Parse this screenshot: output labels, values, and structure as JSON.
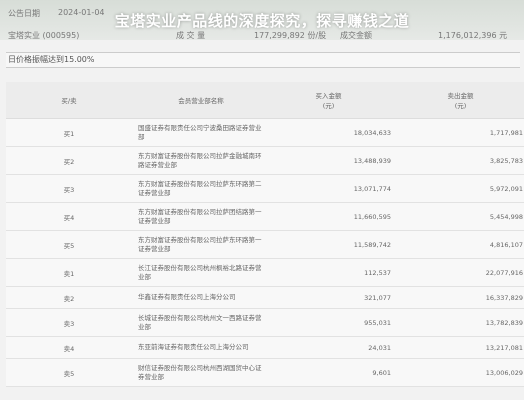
{
  "header": {
    "notice_label": "公告日期",
    "notice_date": "2024-01-04",
    "stock_label": "宝塔实业 (000595)",
    "volume_label": "成 交 量",
    "volume_value": "177,299,892 份/股",
    "amount_label": "成交金额",
    "amount_value": "1,176,012,396 元",
    "title": "宝塔实业产品线的深度探究，探寻赚钱之道"
  },
  "reason": "日价格振幅达到15.00%",
  "table": {
    "headers": [
      "买/卖",
      "会员营业部名称",
      "买入金额\n(元)",
      "卖出金额\n(元)"
    ],
    "rows": [
      {
        "side": "买1",
        "dept": "国盛证券有限责任公司宁波桑田路证券营业部",
        "buy": "18,034,633",
        "sell": "1,717,981"
      },
      {
        "side": "买2",
        "dept": "东方财富证券股份有限公司拉萨金融城南环路证券营业部",
        "buy": "13,488,939",
        "sell": "3,825,783"
      },
      {
        "side": "买3",
        "dept": "东方财富证券股份有限公司拉萨东环路第二证券营业部",
        "buy": "13,071,774",
        "sell": "5,972,091"
      },
      {
        "side": "买4",
        "dept": "东方财富证券股份有限公司拉萨团结路第一证券营业部",
        "buy": "11,660,595",
        "sell": "5,454,998"
      },
      {
        "side": "买5",
        "dept": "东方财富证券股份有限公司拉萨东环路第一证券营业部",
        "buy": "11,589,742",
        "sell": "4,816,107"
      },
      {
        "side": "卖1",
        "dept": "长江证券股份有限公司杭州枫裕北路证券营业部",
        "buy": "112,537",
        "sell": "22,077,916"
      },
      {
        "side": "卖2",
        "dept": "华鑫证券有限责任公司上海分公司",
        "buy": "321,077",
        "sell": "16,337,829"
      },
      {
        "side": "卖3",
        "dept": "长城证券股份有限公司杭州文一西路证券营业部",
        "buy": "955,031",
        "sell": "13,782,839"
      },
      {
        "side": "卖4",
        "dept": "东亚前海证券有限责任公司上海分公司",
        "buy": "24,031",
        "sell": "13,217,081"
      },
      {
        "side": "卖5",
        "dept": "财信证券股份有限公司杭州西湖国贸中心证券营业部",
        "buy": "9,601",
        "sell": "13,006,029"
      }
    ]
  }
}
